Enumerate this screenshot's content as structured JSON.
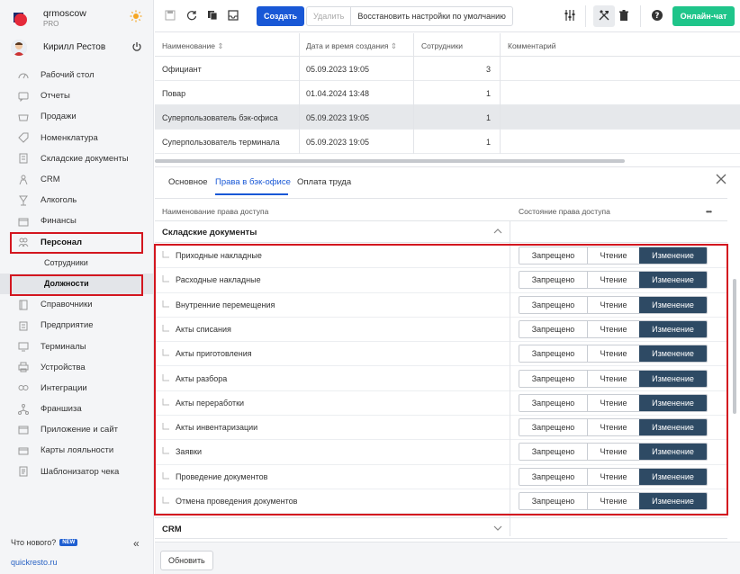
{
  "brand": {
    "name": "qrmoscow",
    "plan": "PRO"
  },
  "user": {
    "name": "Кирилл Рестов"
  },
  "nav": {
    "items": [
      {
        "label": "Рабочий стол",
        "icon": "gauge-icon"
      },
      {
        "label": "Отчеты",
        "icon": "chat-icon"
      },
      {
        "label": "Продажи",
        "icon": "basket-icon"
      },
      {
        "label": "Номенклатура",
        "icon": "tag-icon"
      },
      {
        "label": "Складские документы",
        "icon": "document-icon"
      },
      {
        "label": "CRM",
        "icon": "users-icon"
      },
      {
        "label": "Алкоголь",
        "icon": "glass-icon"
      },
      {
        "label": "Финансы",
        "icon": "wallet-icon"
      },
      {
        "label": "Персонал",
        "icon": "people-icon"
      }
    ],
    "sub_items": [
      "Сотрудники",
      "Должности"
    ],
    "items_after": [
      {
        "label": "Справочники",
        "icon": "book-icon"
      },
      {
        "label": "Предприятие",
        "icon": "building-icon"
      },
      {
        "label": "Терминалы",
        "icon": "monitor-icon"
      },
      {
        "label": "Устройства",
        "icon": "printer-icon"
      },
      {
        "label": "Интеграции",
        "icon": "link-icon"
      },
      {
        "label": "Франшиза",
        "icon": "network-icon"
      },
      {
        "label": "Приложение и сайт",
        "icon": "window-icon"
      },
      {
        "label": "Карты лояльности",
        "icon": "card-icon"
      },
      {
        "label": "Шаблонизатор чека",
        "icon": "receipt-icon"
      }
    ],
    "whats_new": "Что нового?",
    "new_badge": "NEW",
    "site_link": "quickresto.ru"
  },
  "toolbar": {
    "create": "Создать",
    "delete": "Удалить",
    "restore_defaults": "Восстановить настройки по умолчанию",
    "online_chat": "Онлайн-чат"
  },
  "positions_table": {
    "headers": {
      "name": "Наименование",
      "created": "Дата и время создания",
      "employees": "Сотрудники",
      "comment": "Комментарий"
    },
    "rows": [
      {
        "name": "Официант",
        "created": "05.09.2023 19:05",
        "employees": "3",
        "comment": ""
      },
      {
        "name": "Повар",
        "created": "01.04.2024 13:48",
        "employees": "1",
        "comment": ""
      },
      {
        "name": "Суперпользователь бэк-офиса",
        "created": "05.09.2023 19:05",
        "employees": "1",
        "comment": ""
      },
      {
        "name": "Суперпользователь терминала",
        "created": "05.09.2023 19:05",
        "employees": "1",
        "comment": ""
      }
    ]
  },
  "detail": {
    "tabs": [
      "Основное",
      "Права в бэк-офисе",
      "Оплата труда"
    ],
    "active_tab": 1,
    "perm_headers": {
      "name": "Наименование права доступа",
      "state": "Состояние права доступа"
    },
    "group_warehouse": "Складские документы",
    "group_crm": "CRM",
    "states": {
      "denied": "Запрещено",
      "read": "Чтение",
      "edit": "Изменение"
    },
    "permissions": [
      {
        "label": "Приходные накладные",
        "state": "Изменение"
      },
      {
        "label": "Расходные накладные",
        "state": "Изменение"
      },
      {
        "label": "Внутренние перемещения",
        "state": "Изменение"
      },
      {
        "label": "Акты списания",
        "state": "Изменение"
      },
      {
        "label": "Акты приготовления",
        "state": "Изменение"
      },
      {
        "label": "Акты разбора",
        "state": "Изменение"
      },
      {
        "label": "Акты переработки",
        "state": "Изменение"
      },
      {
        "label": "Акты инвентаризации",
        "state": "Изменение"
      },
      {
        "label": "Заявки",
        "state": "Изменение"
      },
      {
        "label": "Проведение документов",
        "state": "Изменение"
      },
      {
        "label": "Отмена проведения документов",
        "state": "Изменение"
      }
    ],
    "refresh": "Обновить"
  },
  "colors": {
    "accent": "#1958d6",
    "online": "#1fc58a",
    "selected_state": "#2e4a64",
    "highlight": "#d3161f"
  }
}
